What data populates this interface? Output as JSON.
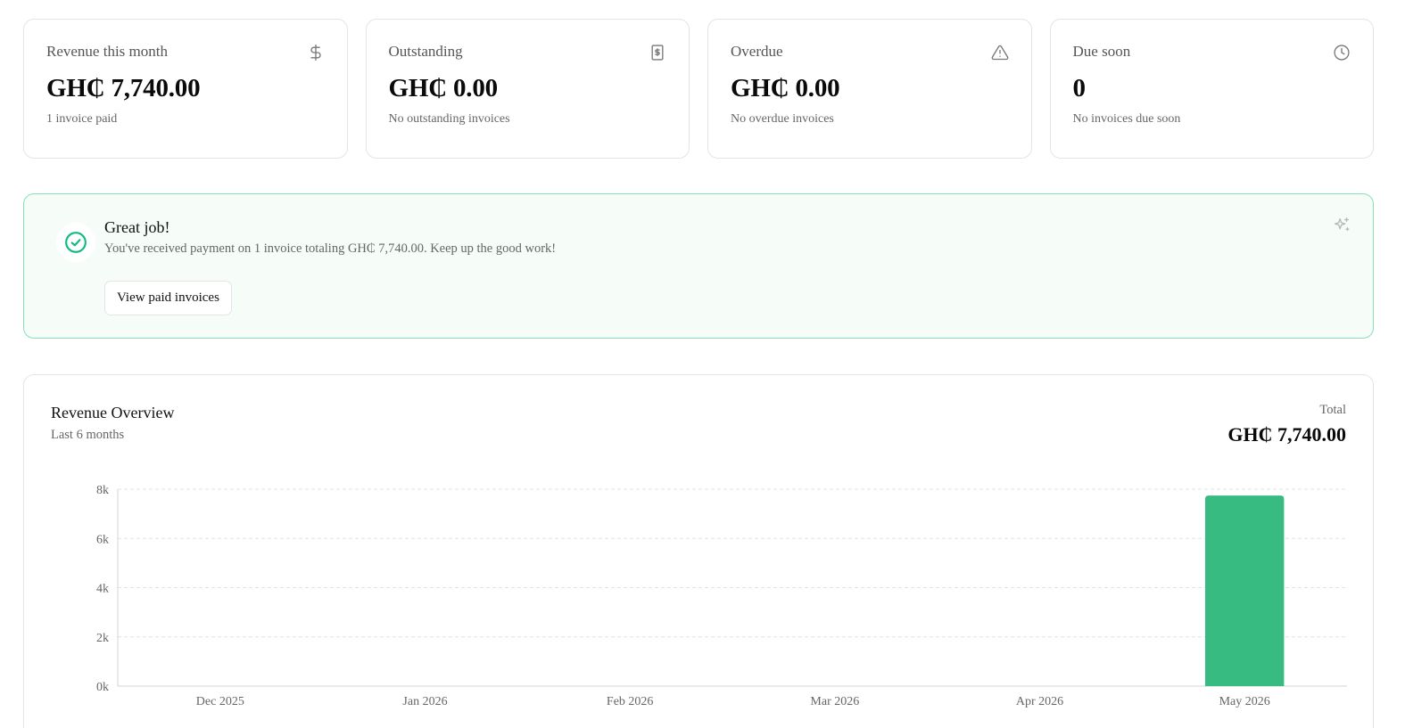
{
  "stats": [
    {
      "title": "Revenue this month",
      "value": "GH₵ 7,740.00",
      "sub": "1 invoice paid",
      "icon": "dollar-icon"
    },
    {
      "title": "Outstanding",
      "value": "GH₵ 0.00",
      "sub": "No outstanding invoices",
      "icon": "receipt-icon"
    },
    {
      "title": "Overdue",
      "value": "GH₵ 0.00",
      "sub": "No overdue invoices",
      "icon": "warning-icon"
    },
    {
      "title": "Due soon",
      "value": "0",
      "sub": "No invoices due soon",
      "icon": "clock-icon"
    }
  ],
  "banner": {
    "title": "Great job!",
    "text": "You've received payment on 1 invoice totaling GH₵ 7,740.00. Keep up the good work!",
    "button_label": "View paid invoices",
    "accent": "#10b981"
  },
  "chart": {
    "title": "Revenue Overview",
    "subtitle": "Last 6 months",
    "total_label": "Total",
    "total_value": "GH₵ 7,740.00"
  },
  "chart_data": {
    "type": "bar",
    "categories": [
      "Dec 2025",
      "Jan 2026",
      "Feb 2026",
      "Mar 2026",
      "Apr 2026",
      "May 2026"
    ],
    "values": [
      0,
      0,
      0,
      0,
      0,
      7740
    ],
    "ylim": [
      0,
      8000
    ],
    "yticks": [
      0,
      2000,
      4000,
      6000,
      8000
    ],
    "ytick_labels": [
      "0k",
      "2k",
      "4k",
      "6k",
      "8k"
    ],
    "grid": true,
    "bar_color": "#37bb80"
  }
}
